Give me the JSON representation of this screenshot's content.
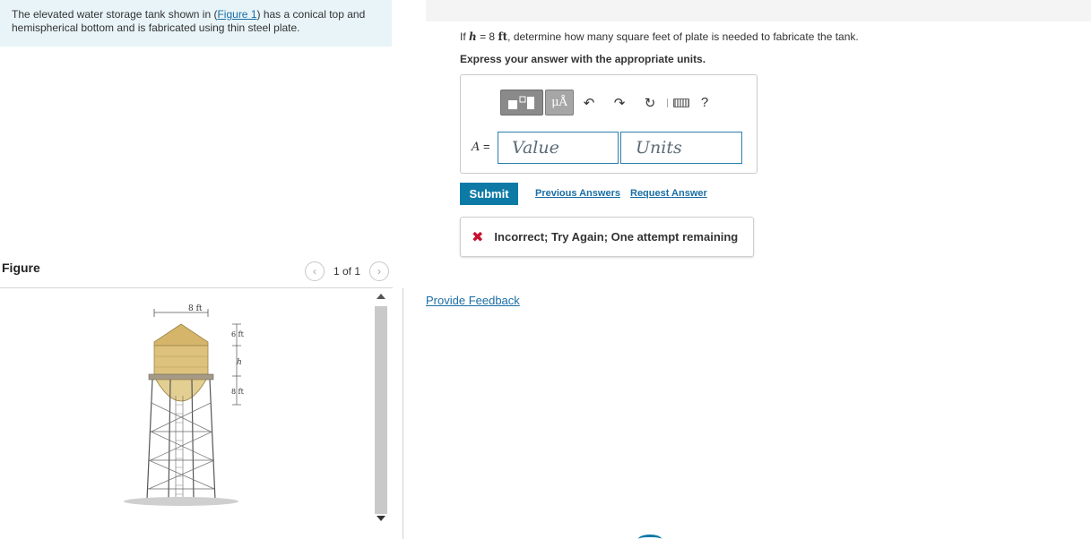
{
  "problem": {
    "text_before": "The elevated water storage tank shown in (",
    "figure_link": "Figure 1",
    "text_after": ") has a conical top and hemispherical bottom and is fabricated using thin steel plate."
  },
  "figure": {
    "title": "Figure",
    "count": "1 of 1",
    "labels": {
      "top_width": "8 ft",
      "cone_height": "6 ft",
      "cyl_height": "h",
      "bottom": "8 ft"
    }
  },
  "question": {
    "prefix": "If ",
    "var": "h",
    "equals": " = 8 ",
    "unit": "ft",
    "suffix": ", determine how many square feet of plate is needed to fabricate the tank."
  },
  "instruction": "Express your answer with the appropriate units.",
  "answer": {
    "label": "A",
    "label_eq": " =",
    "value_placeholder": "Value",
    "units_placeholder": "Units",
    "units_button": "μÅ",
    "help": "?"
  },
  "actions": {
    "submit": "Submit",
    "previous_answers": "Previous Answers",
    "request_answer": "Request Answer"
  },
  "feedback": {
    "icon": "✖",
    "text": "Incorrect; Try Again; One attempt remaining"
  },
  "provide_feedback": "Provide Feedback",
  "colors": {
    "accent": "#0d7aa6",
    "link": "#1a6ea5",
    "error": "#c8102e",
    "problem_bg": "#e8f4f8"
  }
}
